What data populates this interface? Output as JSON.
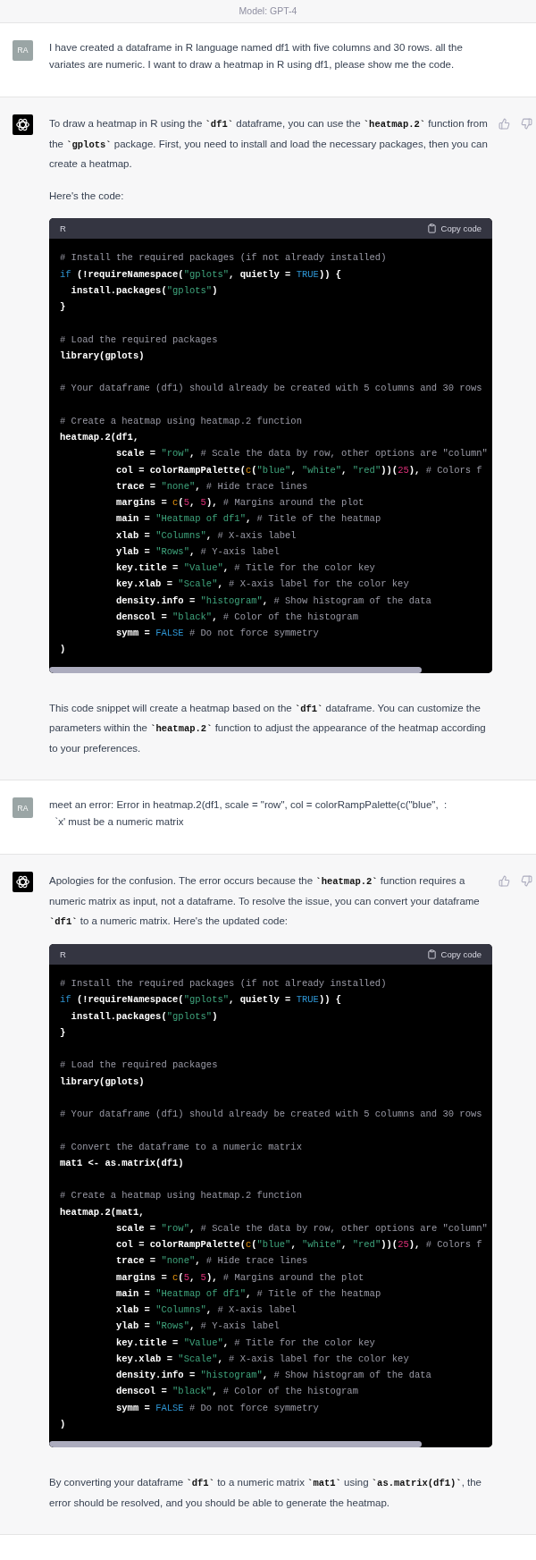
{
  "header": {
    "model_label": "Model: GPT-4"
  },
  "messages": [
    {
      "kind": "user",
      "avatar": "RA",
      "text": "I have created a dataframe in R language named df1 with five columns and 30 rows. all the variates are numeric. I want to draw a heatmap in R using df1, please show me the code."
    },
    {
      "kind": "assistant",
      "blocks": [
        {
          "kind": "paragraph",
          "segments": [
            {
              "kind": "text",
              "text": "To draw a heatmap in R using the "
            },
            {
              "kind": "code",
              "text": "`df1`"
            },
            {
              "kind": "text",
              "text": " dataframe, you can use the "
            },
            {
              "kind": "code",
              "text": "`heatmap.2`"
            },
            {
              "kind": "text",
              "text": " function from the "
            },
            {
              "kind": "code",
              "text": "`gplots`"
            },
            {
              "kind": "text",
              "text": " package. First, you need to install and load the necessary packages, then you can create a heatmap."
            }
          ]
        },
        {
          "kind": "paragraph",
          "segments": [
            {
              "kind": "text",
              "text": "Here's the code:"
            }
          ]
        },
        {
          "kind": "code",
          "language": "R",
          "copy_label": "Copy code",
          "lines": [
            {
              "kind": "code",
              "tokens": [
                {
                  "kind": "comment",
                  "text": "# Install the required packages (if not already installed)"
                }
              ]
            },
            {
              "kind": "code",
              "tokens": [
                {
                  "kind": "keyword",
                  "text": "if"
                },
                {
                  "kind": "plain",
                  "text": " (!requireNamespace("
                },
                {
                  "kind": "string",
                  "text": "\"gplots\""
                },
                {
                  "kind": "plain",
                  "text": ", quietly = "
                },
                {
                  "kind": "literal",
                  "text": "TRUE"
                },
                {
                  "kind": "plain",
                  "text": ")) {"
                }
              ]
            },
            {
              "kind": "code",
              "tokens": [
                {
                  "kind": "plain",
                  "text": "  install.packages("
                },
                {
                  "kind": "string",
                  "text": "\"gplots\""
                },
                {
                  "kind": "plain",
                  "text": ")"
                }
              ]
            },
            {
              "kind": "code",
              "tokens": [
                {
                  "kind": "plain",
                  "text": "}"
                }
              ]
            },
            {
              "kind": "blank"
            },
            {
              "kind": "code",
              "tokens": [
                {
                  "kind": "comment",
                  "text": "# Load the required packages"
                }
              ]
            },
            {
              "kind": "code",
              "tokens": [
                {
                  "kind": "plain",
                  "text": "library(gplots)"
                }
              ]
            },
            {
              "kind": "blank"
            },
            {
              "kind": "code",
              "tokens": [
                {
                  "kind": "comment",
                  "text": "# Your dataframe (df1) should already be created with 5 columns and 30 rows"
                }
              ]
            },
            {
              "kind": "blank"
            },
            {
              "kind": "code",
              "tokens": [
                {
                  "kind": "comment",
                  "text": "# Create a heatmap using heatmap.2 function"
                }
              ]
            },
            {
              "kind": "code",
              "tokens": [
                {
                  "kind": "plain",
                  "text": "heatmap.2(df1,"
                }
              ]
            },
            {
              "kind": "code",
              "tokens": [
                {
                  "kind": "plain",
                  "text": "          scale = "
                },
                {
                  "kind": "string",
                  "text": "\"row\""
                },
                {
                  "kind": "plain",
                  "text": ", "
                },
                {
                  "kind": "comment",
                  "text": "# Scale the data by row, other options are \"column\""
                }
              ]
            },
            {
              "kind": "code",
              "tokens": [
                {
                  "kind": "plain",
                  "text": "          col = colorRampPalette("
                },
                {
                  "kind": "builtin",
                  "text": "c"
                },
                {
                  "kind": "plain",
                  "text": "("
                },
                {
                  "kind": "string",
                  "text": "\"blue\""
                },
                {
                  "kind": "plain",
                  "text": ", "
                },
                {
                  "kind": "string",
                  "text": "\"white\""
                },
                {
                  "kind": "plain",
                  "text": ", "
                },
                {
                  "kind": "string",
                  "text": "\"red\""
                },
                {
                  "kind": "plain",
                  "text": "))("
                },
                {
                  "kind": "number",
                  "text": "25"
                },
                {
                  "kind": "plain",
                  "text": "), "
                },
                {
                  "kind": "comment",
                  "text": "# Colors f"
                }
              ]
            },
            {
              "kind": "code",
              "tokens": [
                {
                  "kind": "plain",
                  "text": "          trace = "
                },
                {
                  "kind": "string",
                  "text": "\"none\""
                },
                {
                  "kind": "plain",
                  "text": ", "
                },
                {
                  "kind": "comment",
                  "text": "# Hide trace lines"
                }
              ]
            },
            {
              "kind": "code",
              "tokens": [
                {
                  "kind": "plain",
                  "text": "          margins = "
                },
                {
                  "kind": "builtin",
                  "text": "c"
                },
                {
                  "kind": "plain",
                  "text": "("
                },
                {
                  "kind": "number",
                  "text": "5"
                },
                {
                  "kind": "plain",
                  "text": ", "
                },
                {
                  "kind": "number",
                  "text": "5"
                },
                {
                  "kind": "plain",
                  "text": "), "
                },
                {
                  "kind": "comment",
                  "text": "# Margins around the plot"
                }
              ]
            },
            {
              "kind": "code",
              "tokens": [
                {
                  "kind": "plain",
                  "text": "          main = "
                },
                {
                  "kind": "string",
                  "text": "\"Heatmap of df1\""
                },
                {
                  "kind": "plain",
                  "text": ", "
                },
                {
                  "kind": "comment",
                  "text": "# Title of the heatmap"
                }
              ]
            },
            {
              "kind": "code",
              "tokens": [
                {
                  "kind": "plain",
                  "text": "          xlab = "
                },
                {
                  "kind": "string",
                  "text": "\"Columns\""
                },
                {
                  "kind": "plain",
                  "text": ", "
                },
                {
                  "kind": "comment",
                  "text": "# X-axis label"
                }
              ]
            },
            {
              "kind": "code",
              "tokens": [
                {
                  "kind": "plain",
                  "text": "          ylab = "
                },
                {
                  "kind": "string",
                  "text": "\"Rows\""
                },
                {
                  "kind": "plain",
                  "text": ", "
                },
                {
                  "kind": "comment",
                  "text": "# Y-axis label"
                }
              ]
            },
            {
              "kind": "code",
              "tokens": [
                {
                  "kind": "plain",
                  "text": "          key.title = "
                },
                {
                  "kind": "string",
                  "text": "\"Value\""
                },
                {
                  "kind": "plain",
                  "text": ", "
                },
                {
                  "kind": "comment",
                  "text": "# Title for the color key"
                }
              ]
            },
            {
              "kind": "code",
              "tokens": [
                {
                  "kind": "plain",
                  "text": "          key.xlab = "
                },
                {
                  "kind": "string",
                  "text": "\"Scale\""
                },
                {
                  "kind": "plain",
                  "text": ", "
                },
                {
                  "kind": "comment",
                  "text": "# X-axis label for the color key"
                }
              ]
            },
            {
              "kind": "code",
              "tokens": [
                {
                  "kind": "plain",
                  "text": "          density.info = "
                },
                {
                  "kind": "string",
                  "text": "\"histogram\""
                },
                {
                  "kind": "plain",
                  "text": ", "
                },
                {
                  "kind": "comment",
                  "text": "# Show histogram of the data"
                }
              ]
            },
            {
              "kind": "code",
              "tokens": [
                {
                  "kind": "plain",
                  "text": "          denscol = "
                },
                {
                  "kind": "string",
                  "text": "\"black\""
                },
                {
                  "kind": "plain",
                  "text": ", "
                },
                {
                  "kind": "comment",
                  "text": "# Color of the histogram"
                }
              ]
            },
            {
              "kind": "code",
              "tokens": [
                {
                  "kind": "plain",
                  "text": "          symm = "
                },
                {
                  "kind": "literal",
                  "text": "FALSE"
                },
                {
                  "kind": "comment",
                  "text": " # Do not force symmetry"
                }
              ]
            },
            {
              "kind": "code",
              "tokens": [
                {
                  "kind": "plain",
                  "text": ")"
                }
              ]
            }
          ]
        },
        {
          "kind": "paragraph",
          "segments": [
            {
              "kind": "text",
              "text": "This code snippet will create a heatmap based on the "
            },
            {
              "kind": "code",
              "text": "`df1`"
            },
            {
              "kind": "text",
              "text": " dataframe. You can customize the parameters within the "
            },
            {
              "kind": "code",
              "text": "`heatmap.2`"
            },
            {
              "kind": "text",
              "text": " function to adjust the appearance of the heatmap according to your preferences."
            }
          ]
        }
      ]
    },
    {
      "kind": "user",
      "avatar": "RA",
      "text": "meet an error: Error in heatmap.2(df1, scale = \"row\", col = colorRampPalette(c(\"blue\",  :\n  `x' must be a numeric matrix"
    },
    {
      "kind": "assistant",
      "blocks": [
        {
          "kind": "paragraph",
          "segments": [
            {
              "kind": "text",
              "text": "Apologies for the confusion. The error occurs because the "
            },
            {
              "kind": "code",
              "text": "`heatmap.2`"
            },
            {
              "kind": "text",
              "text": " function requires a numeric matrix as input, not a dataframe. To resolve the issue, you can convert your dataframe "
            },
            {
              "kind": "code",
              "text": "`df1`"
            },
            {
              "kind": "text",
              "text": " to a numeric matrix. Here's the updated code:"
            }
          ]
        },
        {
          "kind": "code",
          "language": "R",
          "copy_label": "Copy code",
          "lines": [
            {
              "kind": "code",
              "tokens": [
                {
                  "kind": "comment",
                  "text": "# Install the required packages (if not already installed)"
                }
              ]
            },
            {
              "kind": "code",
              "tokens": [
                {
                  "kind": "keyword",
                  "text": "if"
                },
                {
                  "kind": "plain",
                  "text": " (!requireNamespace("
                },
                {
                  "kind": "string",
                  "text": "\"gplots\""
                },
                {
                  "kind": "plain",
                  "text": ", quietly = "
                },
                {
                  "kind": "literal",
                  "text": "TRUE"
                },
                {
                  "kind": "plain",
                  "text": ")) {"
                }
              ]
            },
            {
              "kind": "code",
              "tokens": [
                {
                  "kind": "plain",
                  "text": "  install.packages("
                },
                {
                  "kind": "string",
                  "text": "\"gplots\""
                },
                {
                  "kind": "plain",
                  "text": ")"
                }
              ]
            },
            {
              "kind": "code",
              "tokens": [
                {
                  "kind": "plain",
                  "text": "}"
                }
              ]
            },
            {
              "kind": "blank"
            },
            {
              "kind": "code",
              "tokens": [
                {
                  "kind": "comment",
                  "text": "# Load the required packages"
                }
              ]
            },
            {
              "kind": "code",
              "tokens": [
                {
                  "kind": "plain",
                  "text": "library(gplots)"
                }
              ]
            },
            {
              "kind": "blank"
            },
            {
              "kind": "code",
              "tokens": [
                {
                  "kind": "comment",
                  "text": "# Your dataframe (df1) should already be created with 5 columns and 30 rows"
                }
              ]
            },
            {
              "kind": "blank"
            },
            {
              "kind": "code",
              "tokens": [
                {
                  "kind": "comment",
                  "text": "# Convert the dataframe to a numeric matrix"
                }
              ]
            },
            {
              "kind": "code",
              "tokens": [
                {
                  "kind": "plain",
                  "text": "mat1 <- as.matrix(df1)"
                }
              ]
            },
            {
              "kind": "blank"
            },
            {
              "kind": "code",
              "tokens": [
                {
                  "kind": "comment",
                  "text": "# Create a heatmap using heatmap.2 function"
                }
              ]
            },
            {
              "kind": "code",
              "tokens": [
                {
                  "kind": "plain",
                  "text": "heatmap.2(mat1,"
                }
              ]
            },
            {
              "kind": "code",
              "tokens": [
                {
                  "kind": "plain",
                  "text": "          scale = "
                },
                {
                  "kind": "string",
                  "text": "\"row\""
                },
                {
                  "kind": "plain",
                  "text": ", "
                },
                {
                  "kind": "comment",
                  "text": "# Scale the data by row, other options are \"column\""
                }
              ]
            },
            {
              "kind": "code",
              "tokens": [
                {
                  "kind": "plain",
                  "text": "          col = colorRampPalette("
                },
                {
                  "kind": "builtin",
                  "text": "c"
                },
                {
                  "kind": "plain",
                  "text": "("
                },
                {
                  "kind": "string",
                  "text": "\"blue\""
                },
                {
                  "kind": "plain",
                  "text": ", "
                },
                {
                  "kind": "string",
                  "text": "\"white\""
                },
                {
                  "kind": "plain",
                  "text": ", "
                },
                {
                  "kind": "string",
                  "text": "\"red\""
                },
                {
                  "kind": "plain",
                  "text": "))("
                },
                {
                  "kind": "number",
                  "text": "25"
                },
                {
                  "kind": "plain",
                  "text": "), "
                },
                {
                  "kind": "comment",
                  "text": "# Colors f"
                }
              ]
            },
            {
              "kind": "code",
              "tokens": [
                {
                  "kind": "plain",
                  "text": "          trace = "
                },
                {
                  "kind": "string",
                  "text": "\"none\""
                },
                {
                  "kind": "plain",
                  "text": ", "
                },
                {
                  "kind": "comment",
                  "text": "# Hide trace lines"
                }
              ]
            },
            {
              "kind": "code",
              "tokens": [
                {
                  "kind": "plain",
                  "text": "          margins = "
                },
                {
                  "kind": "builtin",
                  "text": "c"
                },
                {
                  "kind": "plain",
                  "text": "("
                },
                {
                  "kind": "number",
                  "text": "5"
                },
                {
                  "kind": "plain",
                  "text": ", "
                },
                {
                  "kind": "number",
                  "text": "5"
                },
                {
                  "kind": "plain",
                  "text": "), "
                },
                {
                  "kind": "comment",
                  "text": "# Margins around the plot"
                }
              ]
            },
            {
              "kind": "code",
              "tokens": [
                {
                  "kind": "plain",
                  "text": "          main = "
                },
                {
                  "kind": "string",
                  "text": "\"Heatmap of df1\""
                },
                {
                  "kind": "plain",
                  "text": ", "
                },
                {
                  "kind": "comment",
                  "text": "# Title of the heatmap"
                }
              ]
            },
            {
              "kind": "code",
              "tokens": [
                {
                  "kind": "plain",
                  "text": "          xlab = "
                },
                {
                  "kind": "string",
                  "text": "\"Columns\""
                },
                {
                  "kind": "plain",
                  "text": ", "
                },
                {
                  "kind": "comment",
                  "text": "# X-axis label"
                }
              ]
            },
            {
              "kind": "code",
              "tokens": [
                {
                  "kind": "plain",
                  "text": "          ylab = "
                },
                {
                  "kind": "string",
                  "text": "\"Rows\""
                },
                {
                  "kind": "plain",
                  "text": ", "
                },
                {
                  "kind": "comment",
                  "text": "# Y-axis label"
                }
              ]
            },
            {
              "kind": "code",
              "tokens": [
                {
                  "kind": "plain",
                  "text": "          key.title = "
                },
                {
                  "kind": "string",
                  "text": "\"Value\""
                },
                {
                  "kind": "plain",
                  "text": ", "
                },
                {
                  "kind": "comment",
                  "text": "# Title for the color key"
                }
              ]
            },
            {
              "kind": "code",
              "tokens": [
                {
                  "kind": "plain",
                  "text": "          key.xlab = "
                },
                {
                  "kind": "string",
                  "text": "\"Scale\""
                },
                {
                  "kind": "plain",
                  "text": ", "
                },
                {
                  "kind": "comment",
                  "text": "# X-axis label for the color key"
                }
              ]
            },
            {
              "kind": "code",
              "tokens": [
                {
                  "kind": "plain",
                  "text": "          density.info = "
                },
                {
                  "kind": "string",
                  "text": "\"histogram\""
                },
                {
                  "kind": "plain",
                  "text": ", "
                },
                {
                  "kind": "comment",
                  "text": "# Show histogram of the data"
                }
              ]
            },
            {
              "kind": "code",
              "tokens": [
                {
                  "kind": "plain",
                  "text": "          denscol = "
                },
                {
                  "kind": "string",
                  "text": "\"black\""
                },
                {
                  "kind": "plain",
                  "text": ", "
                },
                {
                  "kind": "comment",
                  "text": "# Color of the histogram"
                }
              ]
            },
            {
              "kind": "code",
              "tokens": [
                {
                  "kind": "plain",
                  "text": "          symm = "
                },
                {
                  "kind": "literal",
                  "text": "FALSE"
                },
                {
                  "kind": "comment",
                  "text": " # Do not force symmetry"
                }
              ]
            },
            {
              "kind": "code",
              "tokens": [
                {
                  "kind": "plain",
                  "text": ")"
                }
              ]
            }
          ]
        },
        {
          "kind": "paragraph",
          "segments": [
            {
              "kind": "text",
              "text": "By converting your dataframe "
            },
            {
              "kind": "code",
              "text": "`df1`"
            },
            {
              "kind": "text",
              "text": " to a numeric matrix "
            },
            {
              "kind": "code",
              "text": "`mat1`"
            },
            {
              "kind": "text",
              "text": " using "
            },
            {
              "kind": "code",
              "text": "`as.matrix(df1)`"
            },
            {
              "kind": "text",
              "text": ", the error should be resolved, and you should be able to generate the heatmap."
            }
          ]
        }
      ]
    }
  ]
}
